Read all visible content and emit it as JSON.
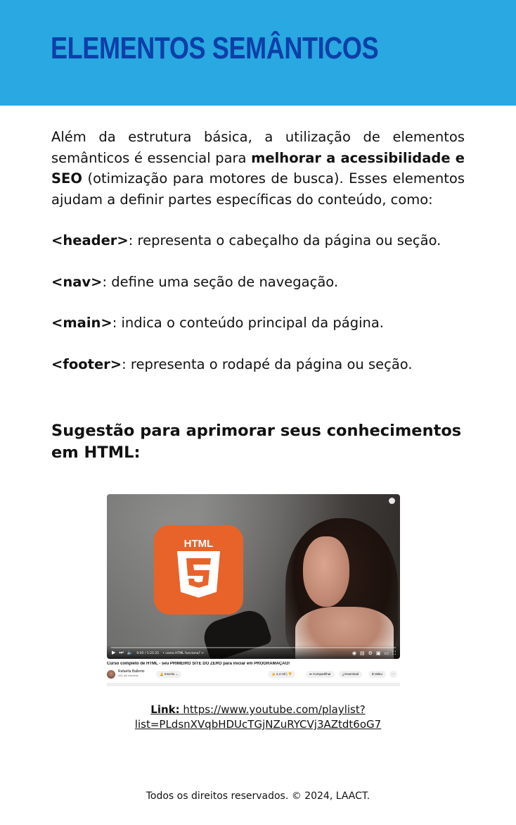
{
  "header": {
    "title": "ELEMENTOS SEMÂNTICOS"
  },
  "intro": {
    "part1": "Além da estrutura básica, a utilização de elementos semânticos é essencial para ",
    "bold": "melhorar a acessibilidade e SEO",
    "part2": " (otimização para motores de busca). Esses elementos ajudam a definir partes específicas do conteúdo, como:"
  },
  "tags": [
    {
      "tag": "<header>",
      "description": ": representa o cabeçalho da página ou seção."
    },
    {
      "tag": "<nav>",
      "description": ": define uma seção de navegação."
    },
    {
      "tag": "<main>",
      "description": ": indica o conteúdo principal da página."
    },
    {
      "tag": "<footer>",
      "description": ": representa o rodapé da página ou seção."
    }
  ],
  "suggestion": {
    "heading": "Sugestão para aprimorar seus conhecimentos em HTML:"
  },
  "video": {
    "logo_text": "HTML",
    "time": "0:05 / 1:21:21",
    "chapter": "• como HTML funciona? >",
    "title": "Curso completo de HTML - seu PRIMEIRO SITE DO ZERO para iniciar em PROGRAMAÇÃO!",
    "channel": "Rafaella Ballerini",
    "subscribers": "331 mil inscritos",
    "subscribed_label": "Inscrito",
    "likes": "2,4 mil",
    "share_label": "Compartilhar",
    "download_label": "Download",
    "clip_label": "Valeu",
    "more_label": "···"
  },
  "link": {
    "label": "Link:",
    "url_line1": "https://www.youtube.com/playlist?",
    "url_line2": "list=PLdsnXVqbHDUcTGjNZuRYCVj3AZtdt6oG7"
  },
  "footer": {
    "text": "Todos os direitos reservados. © 2024, LAACT."
  },
  "colors": {
    "banner": "#29a8e1",
    "title": "#0d3fa8",
    "html_logo": "#e8632a"
  }
}
